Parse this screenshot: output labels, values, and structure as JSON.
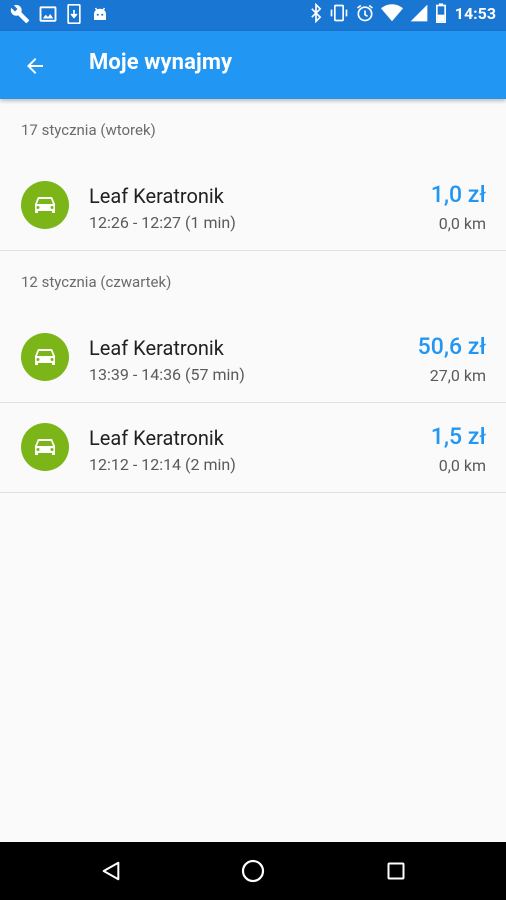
{
  "status_bar": {
    "time": "14:53",
    "left_icons": [
      "wrench-icon",
      "image-icon",
      "download-icon",
      "android-icon"
    ],
    "right_icons": [
      "bluetooth-icon",
      "vibrate-icon",
      "alarm-icon",
      "wifi-icon",
      "signal-icon",
      "battery-icon"
    ]
  },
  "app_bar": {
    "title": "Moje wynajmy",
    "back_icon": "arrow-back-icon"
  },
  "sections": [
    {
      "header": "17 stycznia (wtorek)",
      "rows": [
        {
          "name": "Leaf Keratronik",
          "time_range": "12:26 - 12:27 (1 min)",
          "price": "1,0 zł",
          "distance": "0,0 km"
        }
      ]
    },
    {
      "header": "12 stycznia (czwartek)",
      "rows": [
        {
          "name": "Leaf Keratronik",
          "time_range": "13:39 - 14:36 (57 min)",
          "price": "50,6 zł",
          "distance": "27,0 km"
        },
        {
          "name": "Leaf Keratronik",
          "time_range": "12:12 - 12:14 (2 min)",
          "price": "1,5 zł",
          "distance": "0,0 km"
        }
      ]
    }
  ],
  "colors": {
    "status_bar": "#1976d2",
    "app_bar": "#2196f3",
    "accent_price": "#2196f3",
    "car_avatar": "#7cb518"
  },
  "nav_bar": {
    "buttons": [
      "back-triangle-icon",
      "home-circle-icon",
      "recents-square-icon"
    ]
  }
}
